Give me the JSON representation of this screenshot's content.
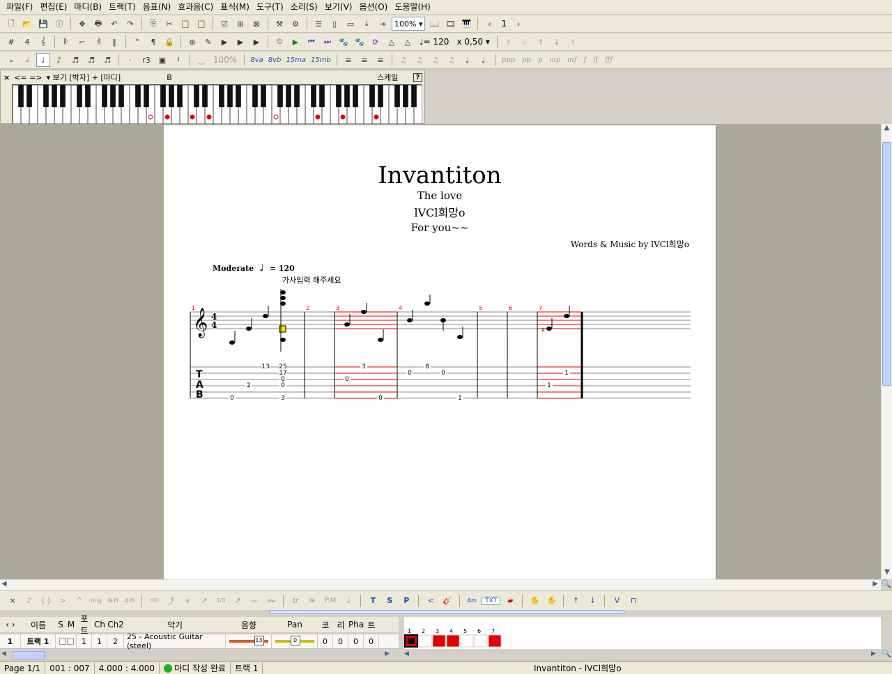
{
  "menu": [
    "파일(F)",
    "편집(E)",
    "마디(B)",
    "트랙(T)",
    "음표(N)",
    "효과음(C)",
    "표식(M)",
    "도구(T)",
    "소리(S)",
    "보기(V)",
    "옵션(O)",
    "도움말(H)"
  ],
  "toolbar1": {
    "zoom": "100%",
    "page_nav": "1"
  },
  "toolbar2": {
    "tempo": "♩= 120",
    "speed": "x 0,50"
  },
  "toolbar3": {
    "velocity": "100%",
    "ottava": [
      "8va",
      "8vb",
      "15ma",
      "15mb"
    ],
    "dynamics": [
      "ppp",
      "pp",
      "p",
      "mp",
      "mf",
      "f",
      "ff",
      "fff"
    ]
  },
  "piano": {
    "close": "×",
    "nav": "<= =>",
    "view": "보기 [박자] + [마디]",
    "note": "B",
    "scale": "스케일",
    "help": "?"
  },
  "score": {
    "title": "Invantiton",
    "subtitle": "The love",
    "artist": "lVCl희망o",
    "album": "For you~~",
    "credits": "Words & Music by lVCl희망o",
    "tempo_label": "Moderate",
    "tempo_value": "= 120",
    "lyrics": "가사입력 해주세요",
    "measure_numbers": [
      "1",
      "2",
      "3",
      "4",
      "5",
      "6",
      "7"
    ],
    "tab_letters": [
      "T",
      "A",
      "B"
    ],
    "tab_numbers": [
      "0",
      "13",
      "25",
      "17",
      "2",
      "0",
      "0",
      "3",
      "3",
      "0",
      "0",
      "8",
      "0",
      "0",
      "1",
      "1",
      "1"
    ]
  },
  "effects": {
    "pm": "P.M",
    "txt": "TXT"
  },
  "tracks": {
    "headers": [
      "이름",
      "S",
      "M",
      "포트",
      "Ch",
      "Ch2",
      "악기",
      "음향",
      "Pan",
      "코",
      "리",
      "Pha",
      "트"
    ],
    "rows": [
      {
        "num": "1",
        "name": "트랙 1",
        "port": "1",
        "ch": "1",
        "ch2": "2",
        "instrument": "25 - Acoustic Guitar (steel)",
        "volume": "13",
        "pan": "0",
        "chorus": "0",
        "reverb": "0",
        "phaser": "0",
        "tremolo": "0"
      }
    ],
    "measure_numbers": [
      "1",
      "2",
      "3",
      "4",
      "5",
      "6",
      "7"
    ]
  },
  "status": {
    "page": "Page 1/1",
    "position": "001 : 007",
    "time_sig": "4.000 : 4.000",
    "message": "마디 작성 완료",
    "track": "트랙 1",
    "file": "Invantiton - lVCl희망o"
  },
  "colors": {
    "accent_red": "#e30000",
    "ui_bg": "#ece9d8",
    "workspace": "#aca899",
    "status_green": "#1db11d"
  }
}
